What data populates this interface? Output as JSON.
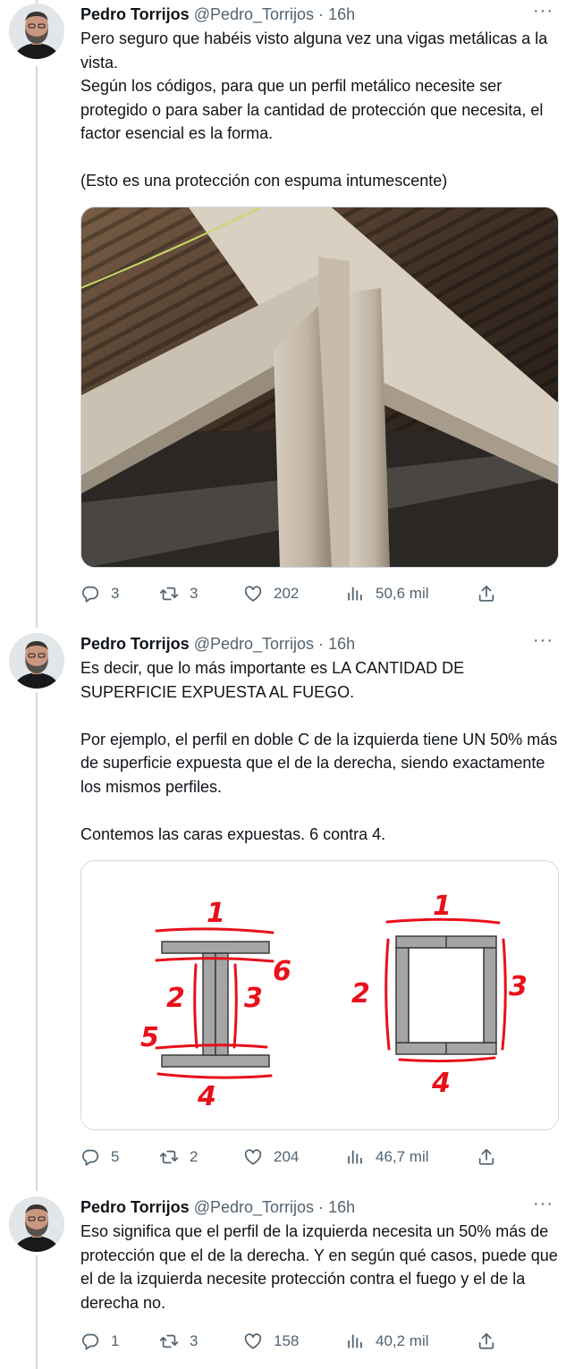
{
  "tweets": [
    {
      "name": "Pedro Torrijos",
      "handle": "@Pedro_Torrijos",
      "dot": "·",
      "time": "16h",
      "text": "Pero seguro que habéis visto alguna vez una vigas metálicas a la vista.\nSegún los códigos, para que un perfil metálico necesite ser protegido o para saber la cantidad de protección que necesita, el factor esencial es la forma.\n\n(Esto es una protección con espuma intumescente)",
      "replies": "3",
      "retweets": "3",
      "likes": "202",
      "views": "50,6 mil"
    },
    {
      "name": "Pedro Torrijos",
      "handle": "@Pedro_Torrijos",
      "dot": "·",
      "time": "16h",
      "text": "Es decir, que lo más importante es LA CANTIDAD DE SUPERFICIE EXPUESTA AL FUEGO.\n\nPor ejemplo, el perfil en doble C de la izquierda tiene UN 50% más de superficie expuesta que el de la derecha, siendo exactamente los mismos perfiles.\n\nContemos las caras expuestas. 6 contra 4.",
      "replies": "5",
      "retweets": "2",
      "likes": "204",
      "views": "46,7 mil",
      "diagram_labels": {
        "l1": "1",
        "l2": "2",
        "l3": "3",
        "l4": "4",
        "l5": "5",
        "l6": "6",
        "r1": "1",
        "r2": "2",
        "r3": "3",
        "r4": "4"
      }
    },
    {
      "name": "Pedro Torrijos",
      "handle": "@Pedro_Torrijos",
      "dot": "·",
      "time": "16h",
      "text": "Eso significa que el perfil de la izquierda necesita un 50% más de protección que el de la derecha. Y en según qué casos, puede que el de la izquierda necesite protección contra el fuego y el de la derecha no.",
      "replies": "1",
      "retweets": "3",
      "likes": "158",
      "views": "40,2 mil"
    }
  ],
  "more_label": "···",
  "colors": {
    "text": "#0f1419",
    "secondary": "#536471",
    "border": "#cfd9de",
    "annotation": "#e8101a"
  },
  "icons": [
    "reply-icon",
    "retweet-icon",
    "like-icon",
    "views-icon",
    "share-icon",
    "more-icon"
  ]
}
